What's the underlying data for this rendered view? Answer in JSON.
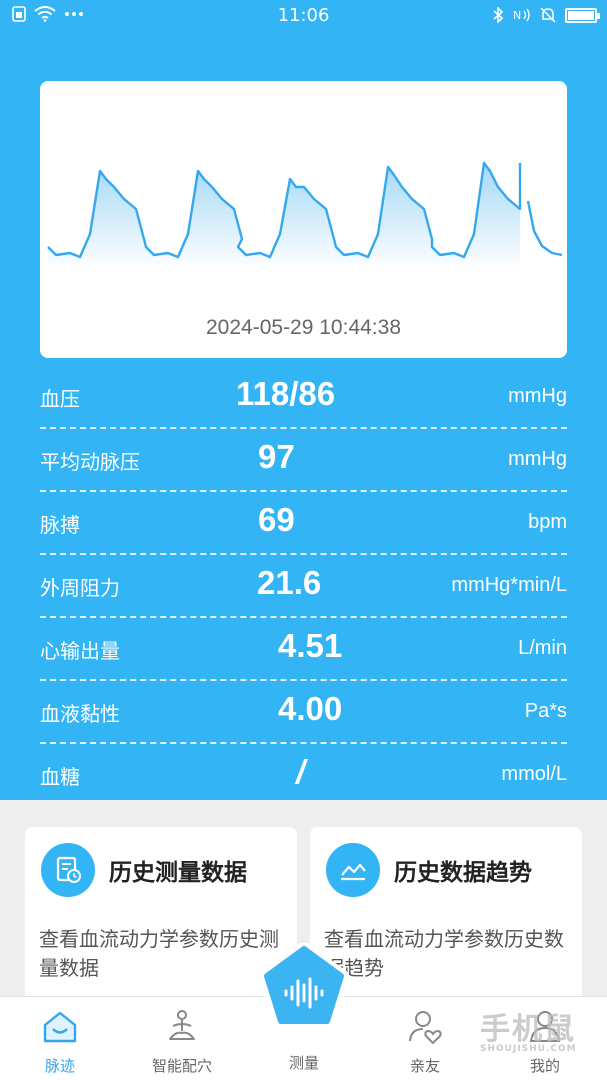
{
  "status_bar": {
    "time": "11:06",
    "left_icons": [
      "sim-icon",
      "wifi-icon",
      "more-dots-icon"
    ],
    "right_icons": [
      "bluetooth-icon",
      "nfc-icon",
      "mute-bell-icon",
      "battery-icon"
    ]
  },
  "waveform": {
    "timestamp": "2024-05-29 10:44:38",
    "color": "#33a8ef"
  },
  "metrics": [
    {
      "label": "血压",
      "value": "118/86",
      "unit": "mmHg"
    },
    {
      "label": "平均动脉压",
      "value": "97",
      "unit": "mmHg"
    },
    {
      "label": "脉搏",
      "value": "69",
      "unit": "bpm"
    },
    {
      "label": "外周阻力",
      "value": "21.6",
      "unit": "mmHg*min/L"
    },
    {
      "label": "心输出量",
      "value": "4.51",
      "unit": "L/min"
    },
    {
      "label": "血液黏性",
      "value": "4.00",
      "unit": "Pa*s"
    },
    {
      "label": "血糖",
      "value": "/",
      "unit": "mmol/L"
    }
  ],
  "cards": [
    {
      "title": "历史测量数据",
      "desc": "查看血流动力学参数历史测量数据",
      "icon": "history-document-icon"
    },
    {
      "title": "历史数据趋势",
      "desc": "查看血流动力学参数历史数据趋势",
      "icon": "trend-chart-icon"
    }
  ],
  "tabs": [
    {
      "label": "脉迹",
      "icon": "home-face-icon",
      "active": true
    },
    {
      "label": "智能配穴",
      "icon": "meditation-icon",
      "active": false
    },
    {
      "label": "测量",
      "icon": "sound-wave-icon",
      "active": false
    },
    {
      "label": "亲友",
      "icon": "friends-heart-icon",
      "active": false
    },
    {
      "label": "我的",
      "icon": "profile-icon",
      "active": false
    }
  ],
  "watermark": {
    "text": "手机鼠",
    "sub": "SHOUJISHU.COM"
  },
  "colors": {
    "primary": "#33b4f4",
    "accent": "#33a6f0",
    "background": "#eeeeee"
  }
}
